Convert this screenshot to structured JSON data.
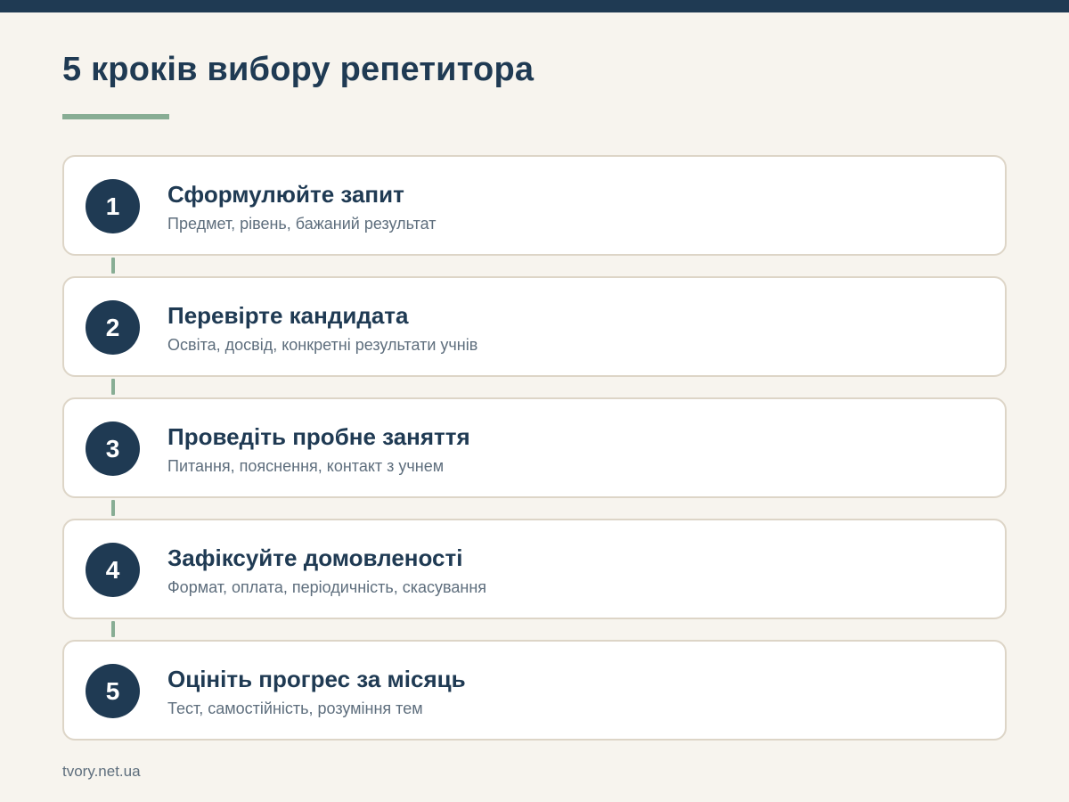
{
  "header": {
    "title": "5 кроків вибору репетитора"
  },
  "steps": [
    {
      "number": "1",
      "title": "Сформулюйте запит",
      "description": "Предмет, рівень, бажаний результат"
    },
    {
      "number": "2",
      "title": "Перевірте кандидата",
      "description": "Освіта, досвід, конкретні результати учнів"
    },
    {
      "number": "3",
      "title": "Проведіть пробне заняття",
      "description": "Питання, пояснення, контакт з учнем"
    },
    {
      "number": "4",
      "title": "Зафіксуйте домовленості",
      "description": "Формат, оплата, періодичність, скасування"
    },
    {
      "number": "5",
      "title": "Оцініть прогрес за місяць",
      "description": "Тест, самостійність, розуміння тем"
    }
  ],
  "footer": {
    "source": "tvory.net.ua"
  },
  "colors": {
    "primary": "#1f3a53",
    "accent": "#88ad94",
    "background": "#f7f4ee",
    "card_border": "#ddd5c7",
    "muted_text": "#5e6e7d"
  }
}
